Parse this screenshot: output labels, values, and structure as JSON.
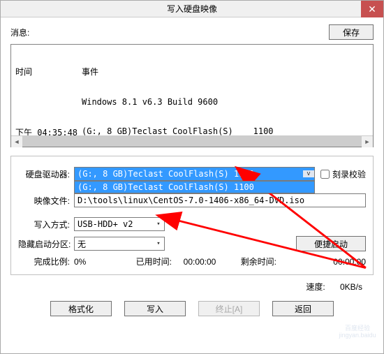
{
  "window": {
    "title": "写入硬盘映像"
  },
  "messages": {
    "label": "消息:",
    "save": "保存",
    "headers": {
      "time": "时间",
      "event": "事件"
    },
    "rows": [
      {
        "time": "",
        "event": "Windows 8.1 v6.3 Build 9600"
      },
      {
        "time": "下午 04:35:48",
        "event": "(G:, 8 GB)Teclast CoolFlash(S)    1100"
      }
    ]
  },
  "fields": {
    "drive": {
      "label": "硬盘驱动器:",
      "value": "(G:, 8 GB)Teclast CoolFlash(S)    1100",
      "options": [
        "(G:, 8 GB)Teclast CoolFlash(S)    1100"
      ],
      "verify_label": "刻录校验",
      "verify_checked": false
    },
    "image": {
      "label": "映像文件:",
      "value": "D:\\tools\\linux\\CentOS-7.0-1406-x86_64-DVD.iso"
    },
    "write_mode": {
      "label": "写入方式:",
      "value": "USB-HDD+ v2"
    },
    "hide_boot": {
      "label": "隐藏启动分区:",
      "value": "无",
      "quick_boot": "便捷启动"
    }
  },
  "status": {
    "done_label": "完成比例:",
    "done_value": "0%",
    "elapsed_label": "已用时间:",
    "elapsed_value": "00:00:00",
    "remain_label": "剩余时间:",
    "remain_value": "00:00:00"
  },
  "speed": {
    "label": "速度:",
    "value": "0KB/s"
  },
  "buttons": {
    "format": "格式化",
    "write": "写入",
    "abort": "终止[A]",
    "back": "返回"
  }
}
